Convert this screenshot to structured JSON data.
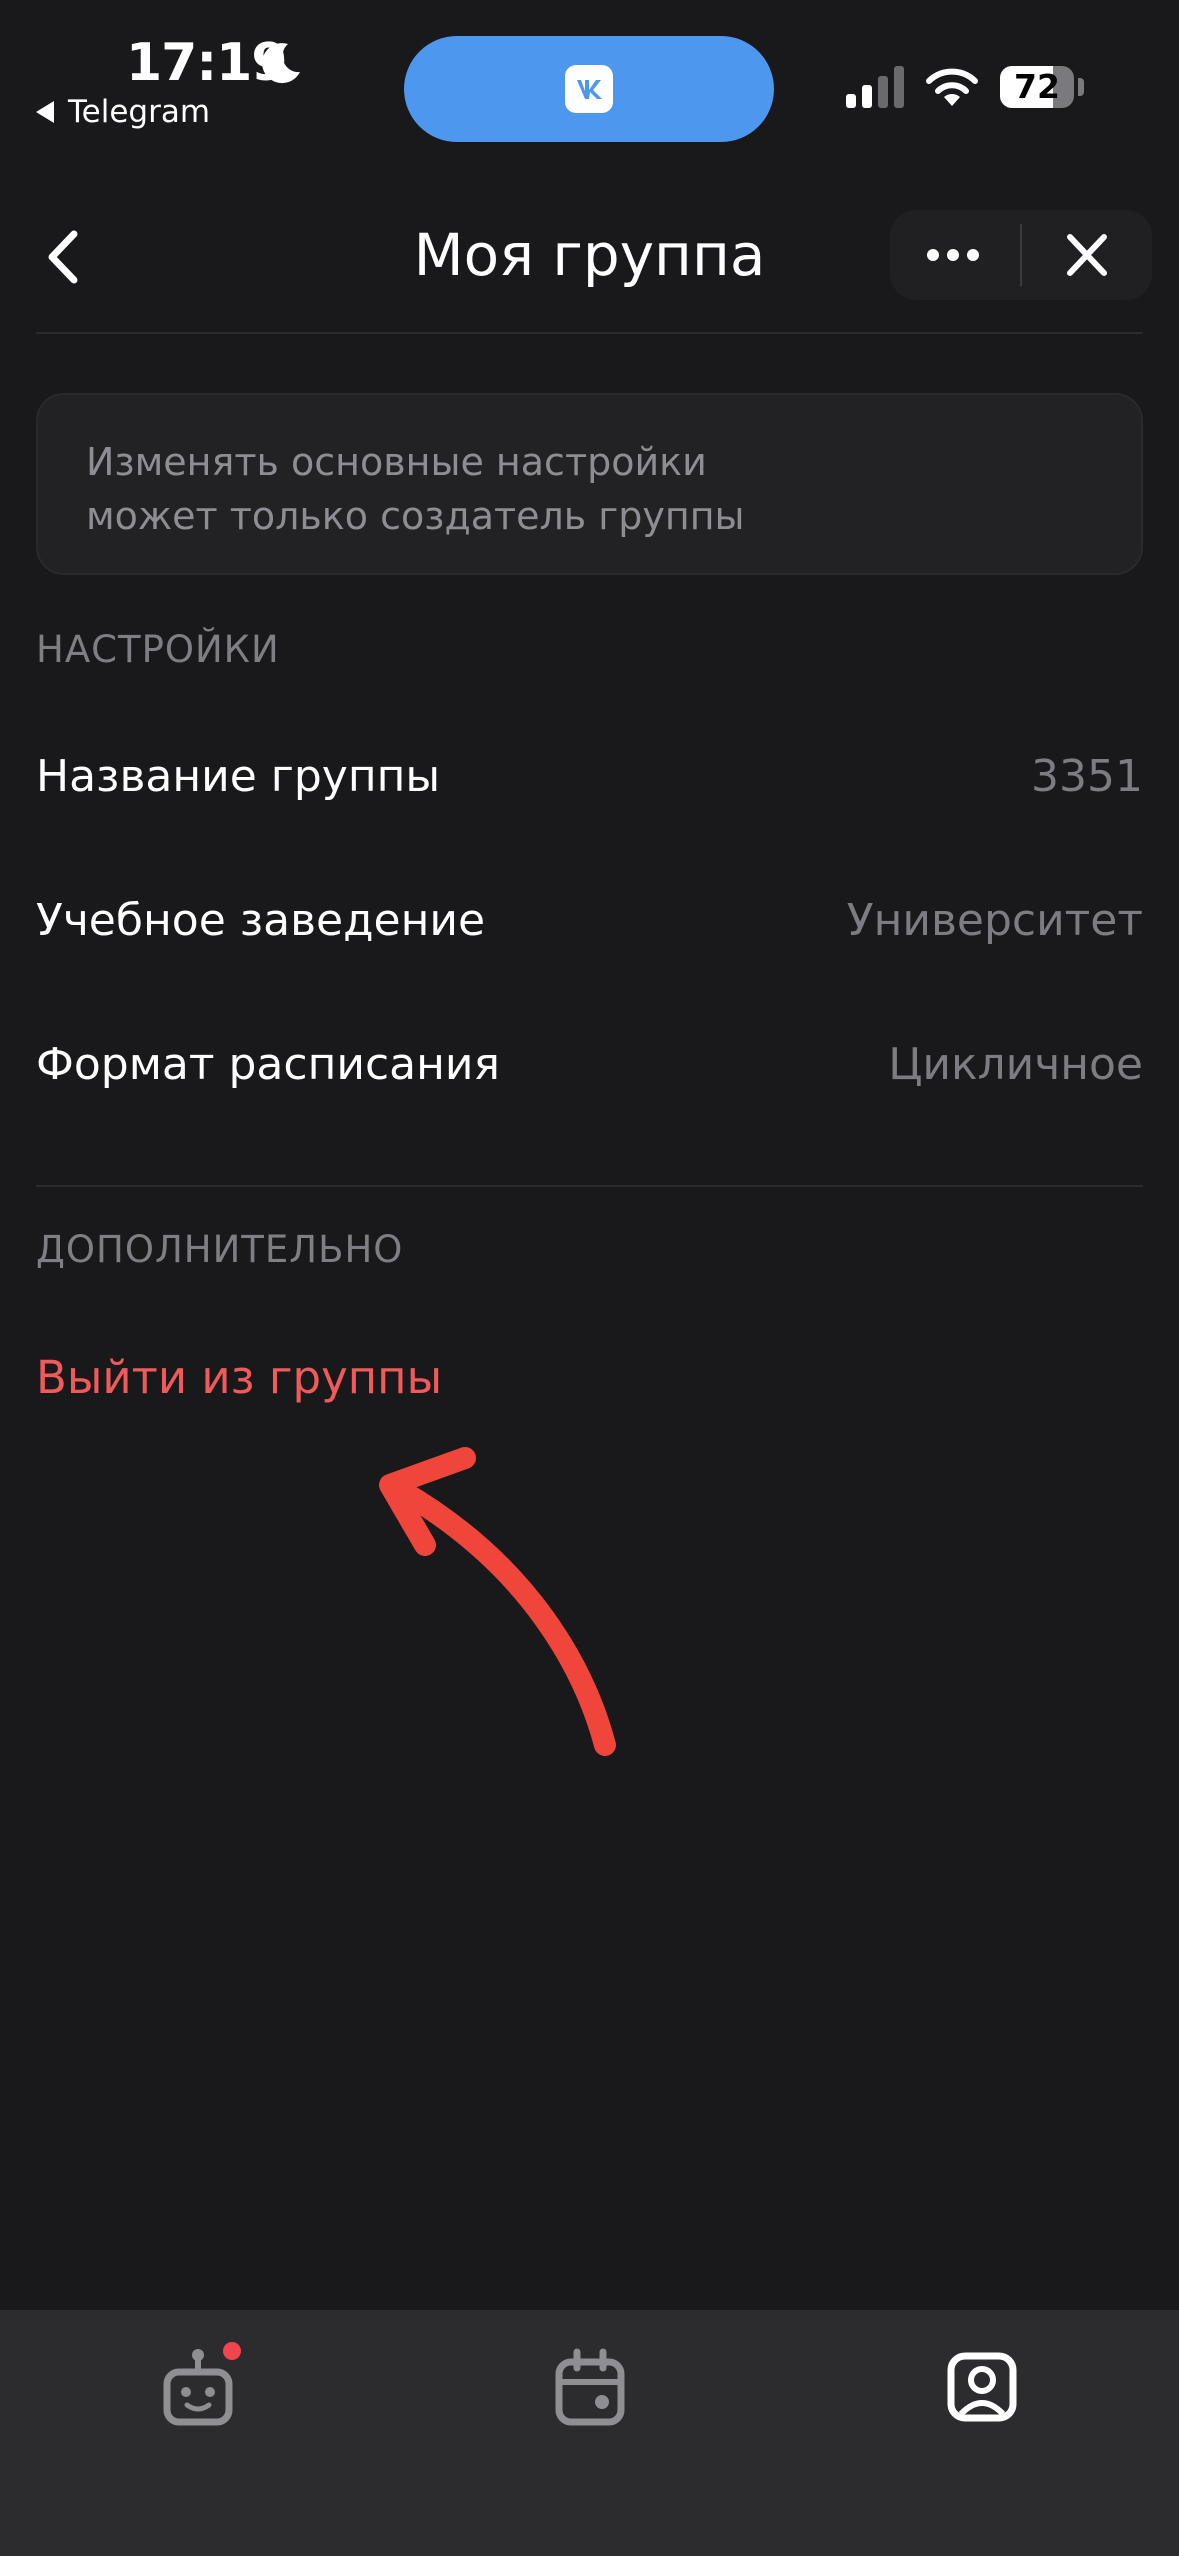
{
  "status_bar": {
    "time": "17:19",
    "back_app": "Telegram",
    "battery_level": "72",
    "battery_fraction": 0.72,
    "icons": [
      "moon-icon",
      "vk-icon",
      "signal-icon",
      "wifi-icon",
      "battery-icon"
    ]
  },
  "nav": {
    "title": "Моя группа",
    "icons": [
      "chevron-left-icon",
      "more-icon",
      "close-icon"
    ]
  },
  "info": {
    "text": "Изменять основные настройки\nможет только создатель группы"
  },
  "settings": {
    "header": "НАСТРОЙКИ",
    "rows": [
      {
        "label": "Название группы",
        "value": "3351"
      },
      {
        "label": "Учебное заведение",
        "value": "Университет"
      },
      {
        "label": "Формат расписания",
        "value": "Цикличное"
      }
    ]
  },
  "extra": {
    "header": "ДОПОЛНИТЕЛЬНО",
    "leave_label": "Выйти из группы"
  },
  "tabs": [
    {
      "icon": "bot-icon",
      "active": false,
      "badge": true
    },
    {
      "icon": "calendar-icon",
      "active": false,
      "badge": false
    },
    {
      "icon": "profile-icon",
      "active": true,
      "badge": false
    }
  ],
  "colors": {
    "background": "#19191b",
    "card": "#222225",
    "danger": "#f05a5a",
    "island": "#4e97ee",
    "badge": "#f0454f",
    "annotation": "#f0453a",
    "tab_inactive": "#8e8e93",
    "tab_active": "#ffffff"
  }
}
